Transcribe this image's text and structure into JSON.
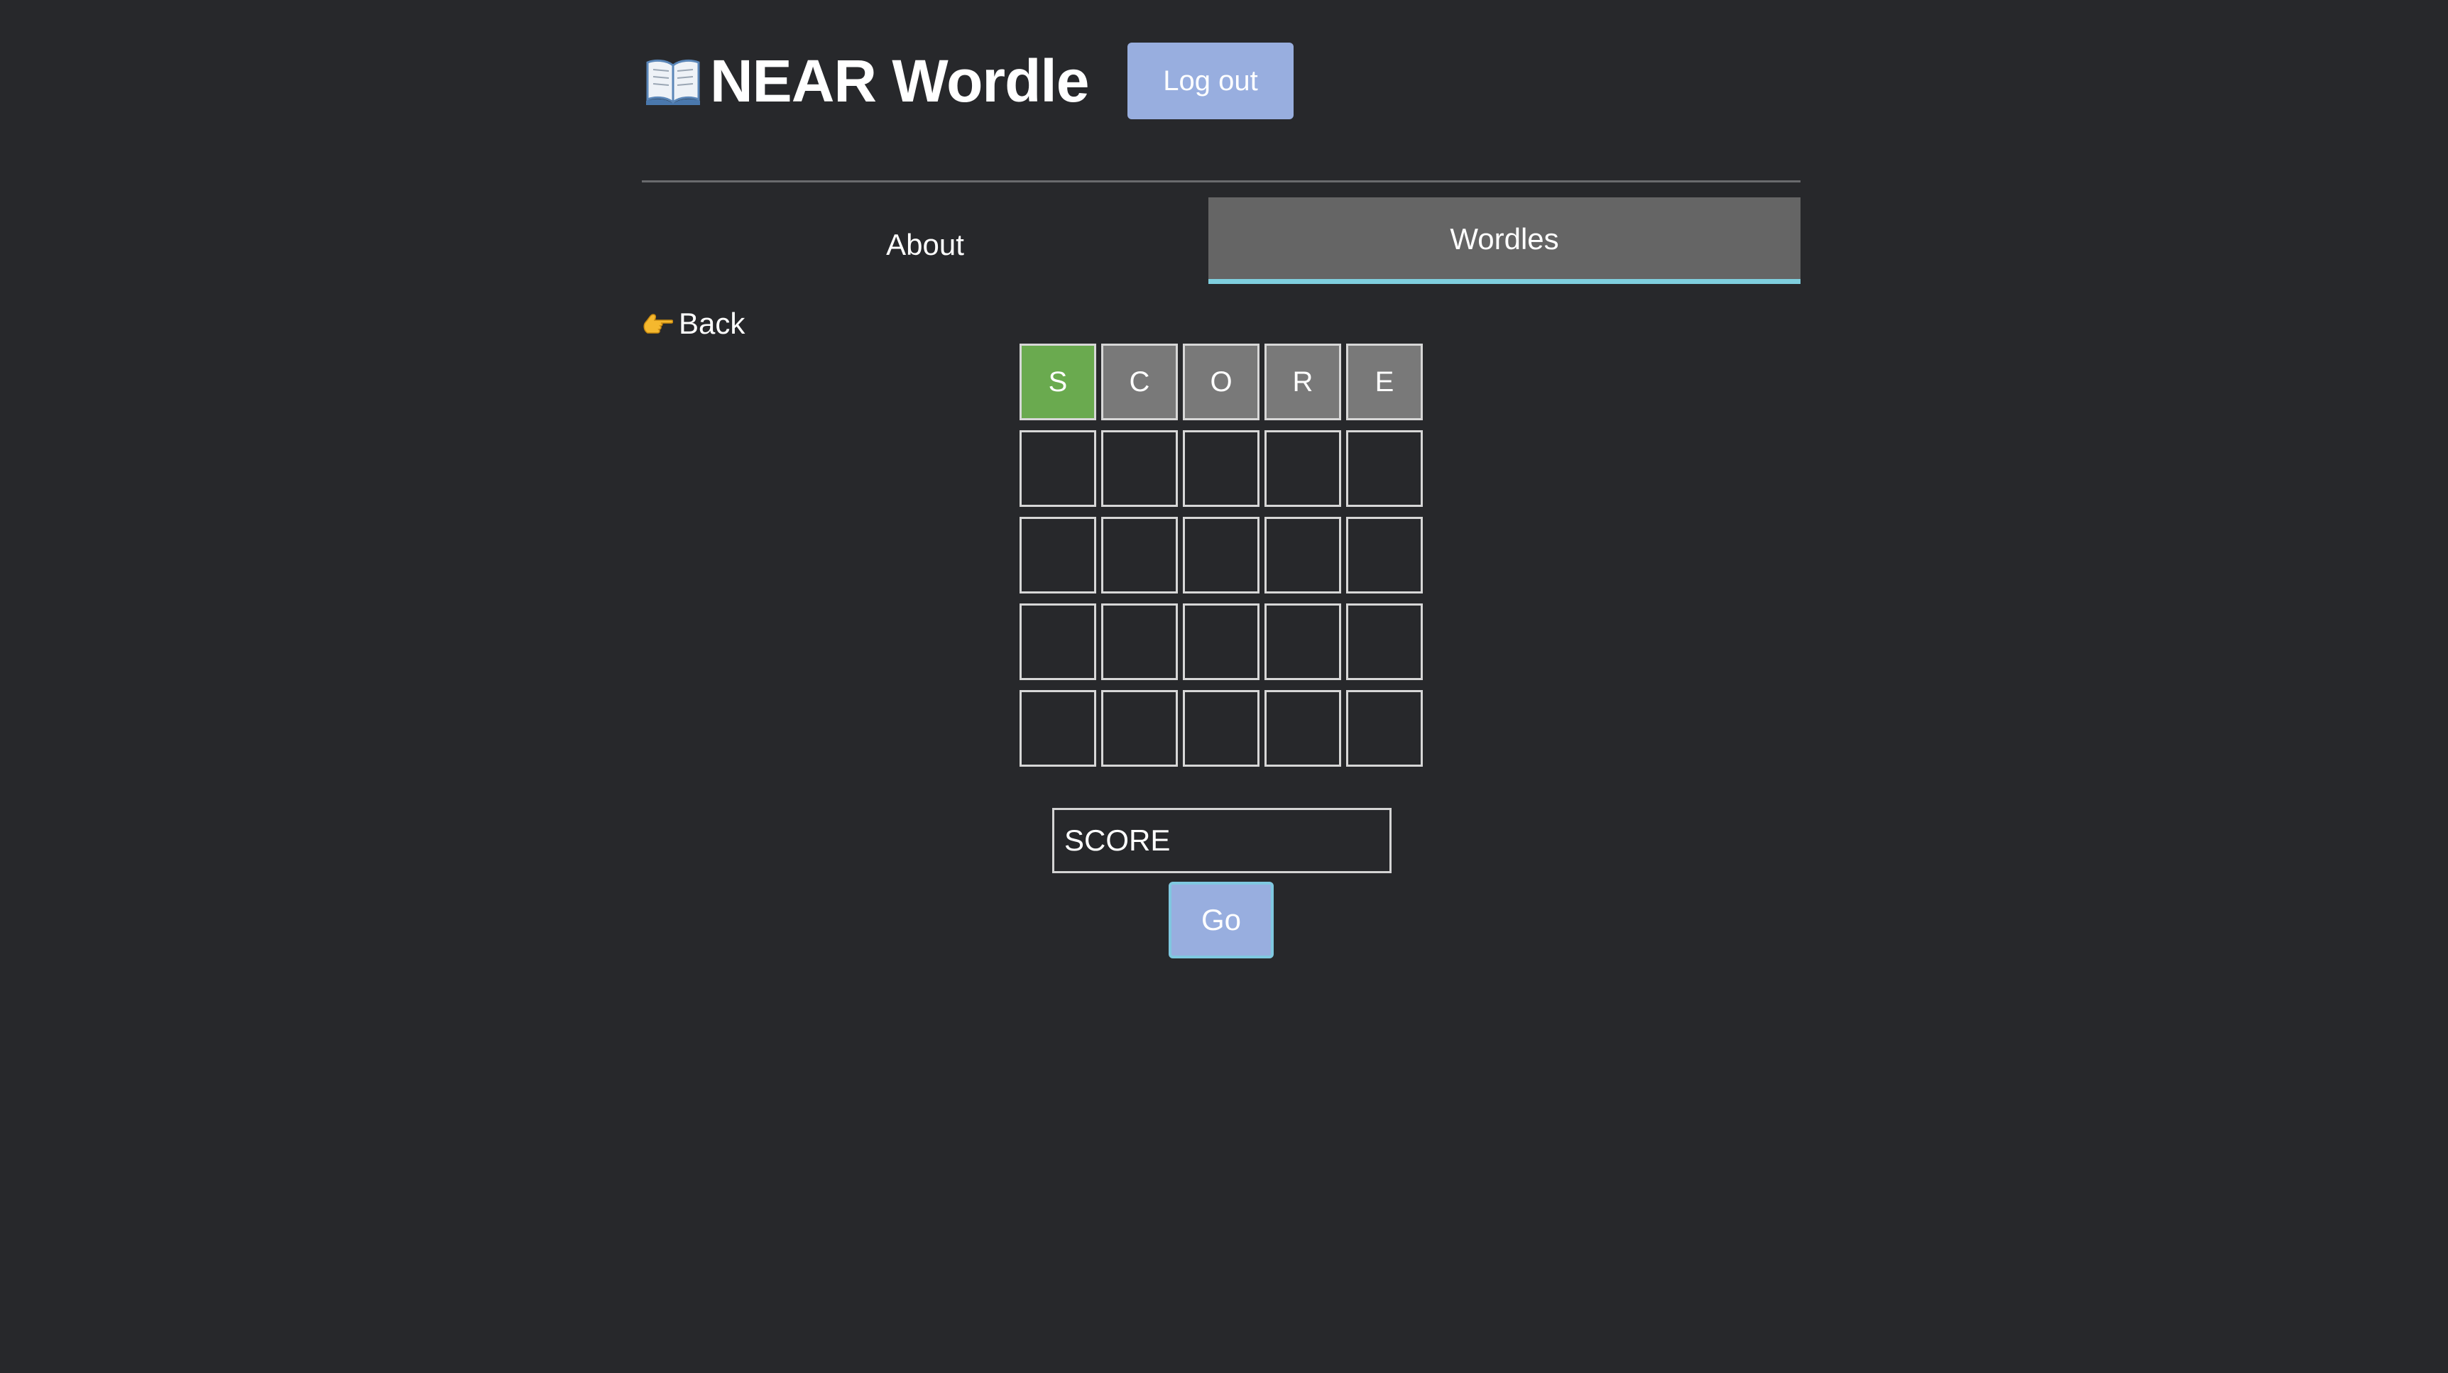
{
  "header": {
    "title": "NEAR Wordle",
    "title_icon": "open-book-icon",
    "logout_label": "Log out"
  },
  "tabs": [
    {
      "label": "About",
      "active": false
    },
    {
      "label": "Wordles",
      "active": true
    }
  ],
  "back": {
    "icon": "pointing-hand-icon",
    "label": "Back"
  },
  "board": {
    "rows": [
      [
        {
          "letter": "S",
          "state": "correct"
        },
        {
          "letter": "C",
          "state": "absent"
        },
        {
          "letter": "O",
          "state": "absent"
        },
        {
          "letter": "R",
          "state": "absent"
        },
        {
          "letter": "E",
          "state": "absent"
        }
      ],
      [
        {
          "letter": "",
          "state": "empty"
        },
        {
          "letter": "",
          "state": "empty"
        },
        {
          "letter": "",
          "state": "empty"
        },
        {
          "letter": "",
          "state": "empty"
        },
        {
          "letter": "",
          "state": "empty"
        }
      ],
      [
        {
          "letter": "",
          "state": "empty"
        },
        {
          "letter": "",
          "state": "empty"
        },
        {
          "letter": "",
          "state": "empty"
        },
        {
          "letter": "",
          "state": "empty"
        },
        {
          "letter": "",
          "state": "empty"
        }
      ],
      [
        {
          "letter": "",
          "state": "empty"
        },
        {
          "letter": "",
          "state": "empty"
        },
        {
          "letter": "",
          "state": "empty"
        },
        {
          "letter": "",
          "state": "empty"
        },
        {
          "letter": "",
          "state": "empty"
        }
      ],
      [
        {
          "letter": "",
          "state": "empty"
        },
        {
          "letter": "",
          "state": "empty"
        },
        {
          "letter": "",
          "state": "empty"
        },
        {
          "letter": "",
          "state": "empty"
        },
        {
          "letter": "",
          "state": "empty"
        }
      ]
    ]
  },
  "guess": {
    "value": "SCORE",
    "submit_label": "Go"
  },
  "colors": {
    "background": "#27282b",
    "button": "#98aedf",
    "active_tab": "#656565",
    "tab_underline": "#7fcfde",
    "correct": "#6aaa4f",
    "absent": "#797979"
  }
}
